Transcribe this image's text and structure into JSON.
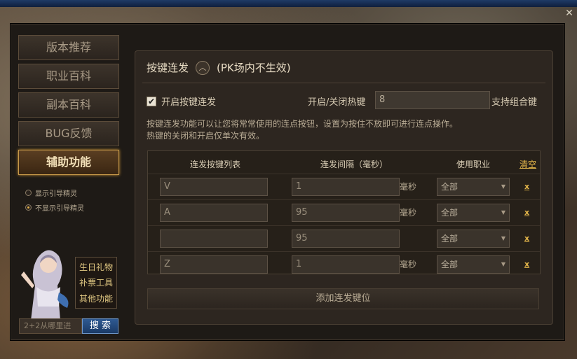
{
  "sidebar": {
    "items": [
      {
        "label": "版本推荐"
      },
      {
        "label": "职业百科"
      },
      {
        "label": "副本百科"
      },
      {
        "label": "BUG反馈"
      },
      {
        "label": "辅助功能",
        "active": true
      }
    ],
    "radio_options": [
      {
        "label": "显示引导精灵",
        "checked": false
      },
      {
        "label": "不显示引导精灵",
        "checked": true
      }
    ],
    "side_links": [
      "生日礼物",
      "补票工具",
      "其他功能"
    ],
    "search": {
      "placeholder": "2+2从哪里进",
      "button_label": "搜 索"
    }
  },
  "content": {
    "section_title": "按键连发",
    "section_note": "(PK场内不生效)",
    "enable_checkbox": {
      "label": "开启按键连发",
      "checked": true
    },
    "hotkey": {
      "label": "开启/关闭热键",
      "value": "8",
      "note": "支持组合键"
    },
    "description": [
      "按键连发功能可以让您将常常使用的连点按钮，设置为按住不放即可进行连点操作。",
      "热键的关闭和开启仅单次有效。"
    ],
    "table": {
      "headers": [
        "连发按键列表",
        "连发间隔（毫秒）",
        "使用职业"
      ],
      "clear_label": "清空",
      "unit": "毫秒",
      "delete_label": "x",
      "rows": [
        {
          "key": "V",
          "interval": "1",
          "job": "全部"
        },
        {
          "key": "A",
          "interval": "95",
          "job": "全部"
        },
        {
          "key": "",
          "interval": "95",
          "job": "全部"
        },
        {
          "key": "Z",
          "interval": "1",
          "job": "全部"
        }
      ]
    },
    "add_button_label": "添加连发键位"
  },
  "colors": {
    "accent": "#e2b54a",
    "active_nav": "#c89a4a",
    "search_button": "#2f5a92"
  }
}
